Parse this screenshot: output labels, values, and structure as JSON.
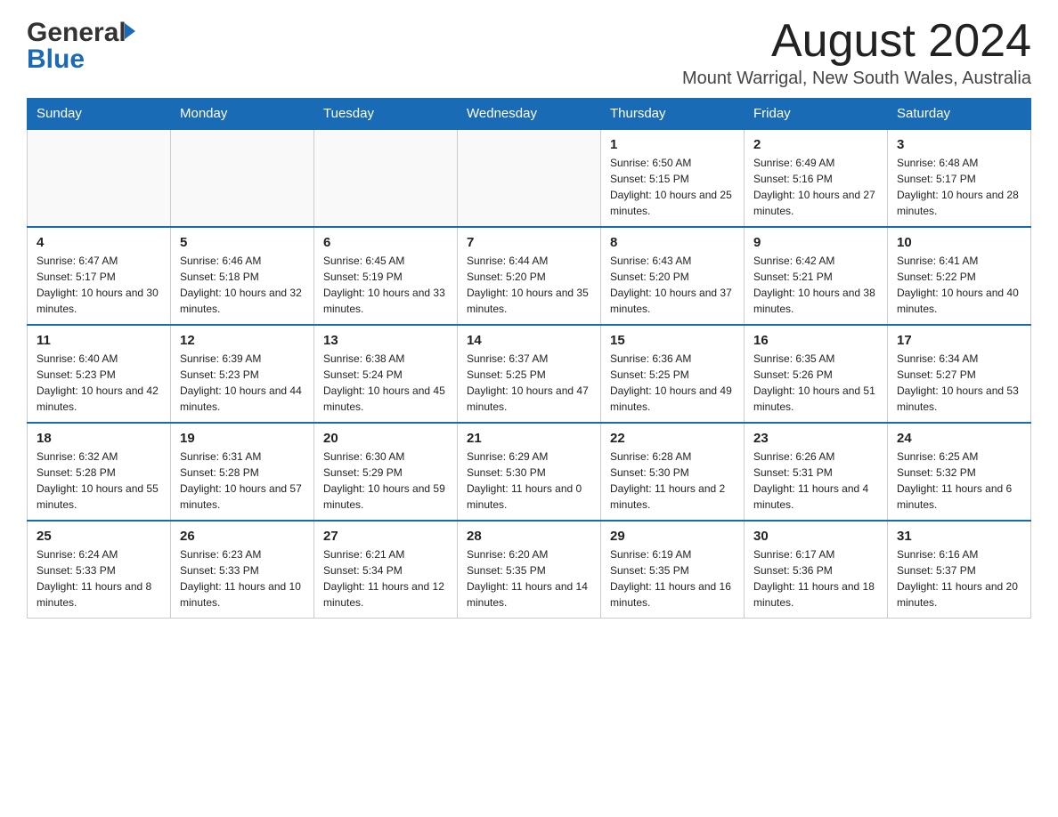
{
  "header": {
    "logo_general": "General",
    "logo_blue": "Blue",
    "month_title": "August 2024",
    "location": "Mount Warrigal, New South Wales, Australia"
  },
  "days_of_week": [
    "Sunday",
    "Monday",
    "Tuesday",
    "Wednesday",
    "Thursday",
    "Friday",
    "Saturday"
  ],
  "weeks": [
    [
      {
        "day": "",
        "info": ""
      },
      {
        "day": "",
        "info": ""
      },
      {
        "day": "",
        "info": ""
      },
      {
        "day": "",
        "info": ""
      },
      {
        "day": "1",
        "info": "Sunrise: 6:50 AM\nSunset: 5:15 PM\nDaylight: 10 hours and 25 minutes."
      },
      {
        "day": "2",
        "info": "Sunrise: 6:49 AM\nSunset: 5:16 PM\nDaylight: 10 hours and 27 minutes."
      },
      {
        "day": "3",
        "info": "Sunrise: 6:48 AM\nSunset: 5:17 PM\nDaylight: 10 hours and 28 minutes."
      }
    ],
    [
      {
        "day": "4",
        "info": "Sunrise: 6:47 AM\nSunset: 5:17 PM\nDaylight: 10 hours and 30 minutes."
      },
      {
        "day": "5",
        "info": "Sunrise: 6:46 AM\nSunset: 5:18 PM\nDaylight: 10 hours and 32 minutes."
      },
      {
        "day": "6",
        "info": "Sunrise: 6:45 AM\nSunset: 5:19 PM\nDaylight: 10 hours and 33 minutes."
      },
      {
        "day": "7",
        "info": "Sunrise: 6:44 AM\nSunset: 5:20 PM\nDaylight: 10 hours and 35 minutes."
      },
      {
        "day": "8",
        "info": "Sunrise: 6:43 AM\nSunset: 5:20 PM\nDaylight: 10 hours and 37 minutes."
      },
      {
        "day": "9",
        "info": "Sunrise: 6:42 AM\nSunset: 5:21 PM\nDaylight: 10 hours and 38 minutes."
      },
      {
        "day": "10",
        "info": "Sunrise: 6:41 AM\nSunset: 5:22 PM\nDaylight: 10 hours and 40 minutes."
      }
    ],
    [
      {
        "day": "11",
        "info": "Sunrise: 6:40 AM\nSunset: 5:23 PM\nDaylight: 10 hours and 42 minutes."
      },
      {
        "day": "12",
        "info": "Sunrise: 6:39 AM\nSunset: 5:23 PM\nDaylight: 10 hours and 44 minutes."
      },
      {
        "day": "13",
        "info": "Sunrise: 6:38 AM\nSunset: 5:24 PM\nDaylight: 10 hours and 45 minutes."
      },
      {
        "day": "14",
        "info": "Sunrise: 6:37 AM\nSunset: 5:25 PM\nDaylight: 10 hours and 47 minutes."
      },
      {
        "day": "15",
        "info": "Sunrise: 6:36 AM\nSunset: 5:25 PM\nDaylight: 10 hours and 49 minutes."
      },
      {
        "day": "16",
        "info": "Sunrise: 6:35 AM\nSunset: 5:26 PM\nDaylight: 10 hours and 51 minutes."
      },
      {
        "day": "17",
        "info": "Sunrise: 6:34 AM\nSunset: 5:27 PM\nDaylight: 10 hours and 53 minutes."
      }
    ],
    [
      {
        "day": "18",
        "info": "Sunrise: 6:32 AM\nSunset: 5:28 PM\nDaylight: 10 hours and 55 minutes."
      },
      {
        "day": "19",
        "info": "Sunrise: 6:31 AM\nSunset: 5:28 PM\nDaylight: 10 hours and 57 minutes."
      },
      {
        "day": "20",
        "info": "Sunrise: 6:30 AM\nSunset: 5:29 PM\nDaylight: 10 hours and 59 minutes."
      },
      {
        "day": "21",
        "info": "Sunrise: 6:29 AM\nSunset: 5:30 PM\nDaylight: 11 hours and 0 minutes."
      },
      {
        "day": "22",
        "info": "Sunrise: 6:28 AM\nSunset: 5:30 PM\nDaylight: 11 hours and 2 minutes."
      },
      {
        "day": "23",
        "info": "Sunrise: 6:26 AM\nSunset: 5:31 PM\nDaylight: 11 hours and 4 minutes."
      },
      {
        "day": "24",
        "info": "Sunrise: 6:25 AM\nSunset: 5:32 PM\nDaylight: 11 hours and 6 minutes."
      }
    ],
    [
      {
        "day": "25",
        "info": "Sunrise: 6:24 AM\nSunset: 5:33 PM\nDaylight: 11 hours and 8 minutes."
      },
      {
        "day": "26",
        "info": "Sunrise: 6:23 AM\nSunset: 5:33 PM\nDaylight: 11 hours and 10 minutes."
      },
      {
        "day": "27",
        "info": "Sunrise: 6:21 AM\nSunset: 5:34 PM\nDaylight: 11 hours and 12 minutes."
      },
      {
        "day": "28",
        "info": "Sunrise: 6:20 AM\nSunset: 5:35 PM\nDaylight: 11 hours and 14 minutes."
      },
      {
        "day": "29",
        "info": "Sunrise: 6:19 AM\nSunset: 5:35 PM\nDaylight: 11 hours and 16 minutes."
      },
      {
        "day": "30",
        "info": "Sunrise: 6:17 AM\nSunset: 5:36 PM\nDaylight: 11 hours and 18 minutes."
      },
      {
        "day": "31",
        "info": "Sunrise: 6:16 AM\nSunset: 5:37 PM\nDaylight: 11 hours and 20 minutes."
      }
    ]
  ]
}
